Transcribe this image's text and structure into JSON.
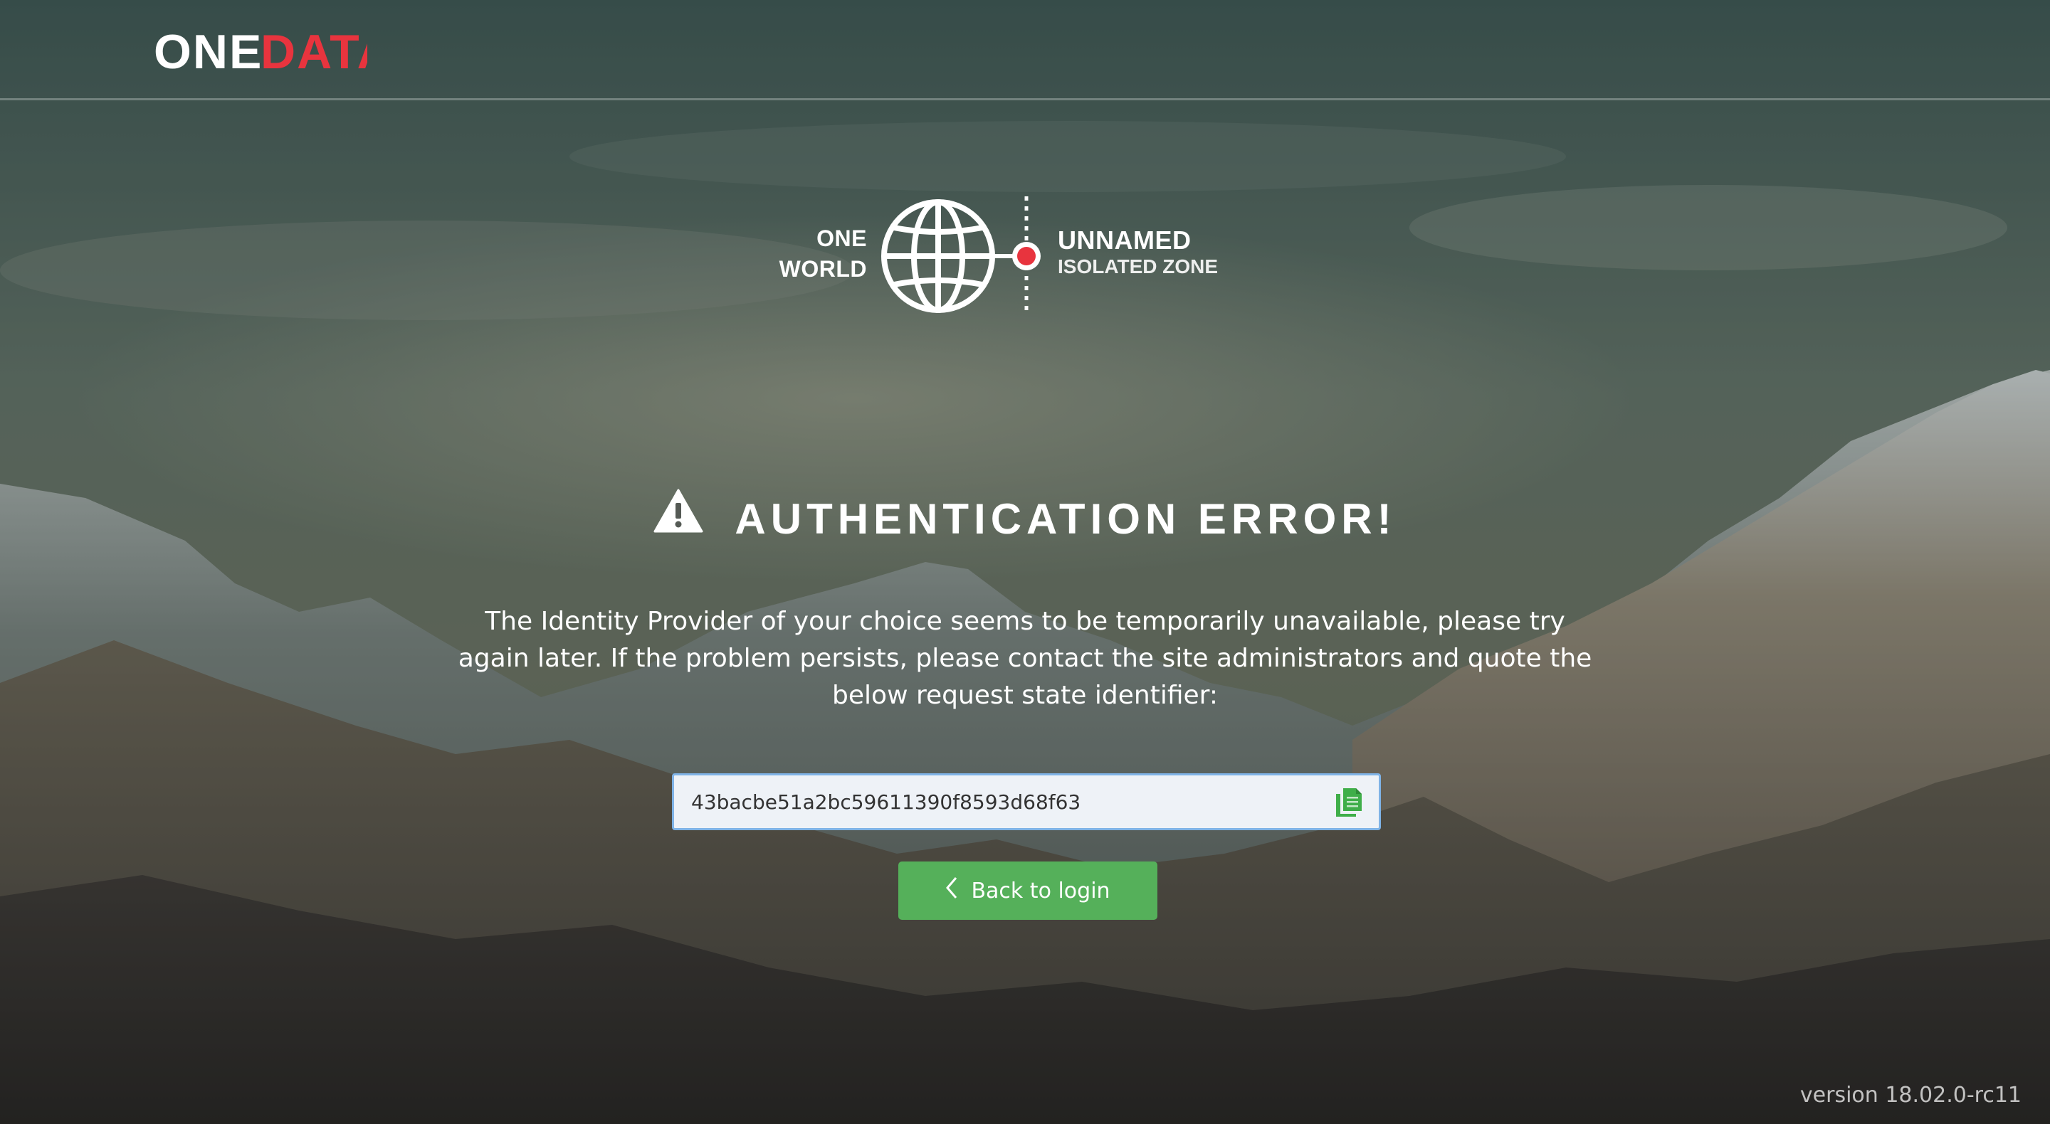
{
  "brand": {
    "logo_part1": "ONE",
    "logo_part2": "DATA",
    "accent_color": "#e8343e"
  },
  "zone": {
    "left_line1": "ONE",
    "left_line2": "WORLD",
    "name": "UNNAMED",
    "subtitle": "ISOLATED ZONE",
    "icon": "globe-icon"
  },
  "error": {
    "icon": "warning-icon",
    "title": "AUTHENTICATION ERROR!",
    "message": "The Identity Provider of your choice seems to be temporarily unavailable, please try again later. If the problem persists, please contact the site administrators and quote the below request state identifier:"
  },
  "state_identifier": {
    "value": "43bacbe51a2bc59611390f8593d68f63",
    "copy_icon": "copy-icon",
    "copy_icon_color": "#3fae49"
  },
  "back_button": {
    "label": "Back to login",
    "icon": "chevron-left-icon",
    "color": "#55b05a"
  },
  "footer": {
    "version": "version 18.02.0-rc11"
  }
}
